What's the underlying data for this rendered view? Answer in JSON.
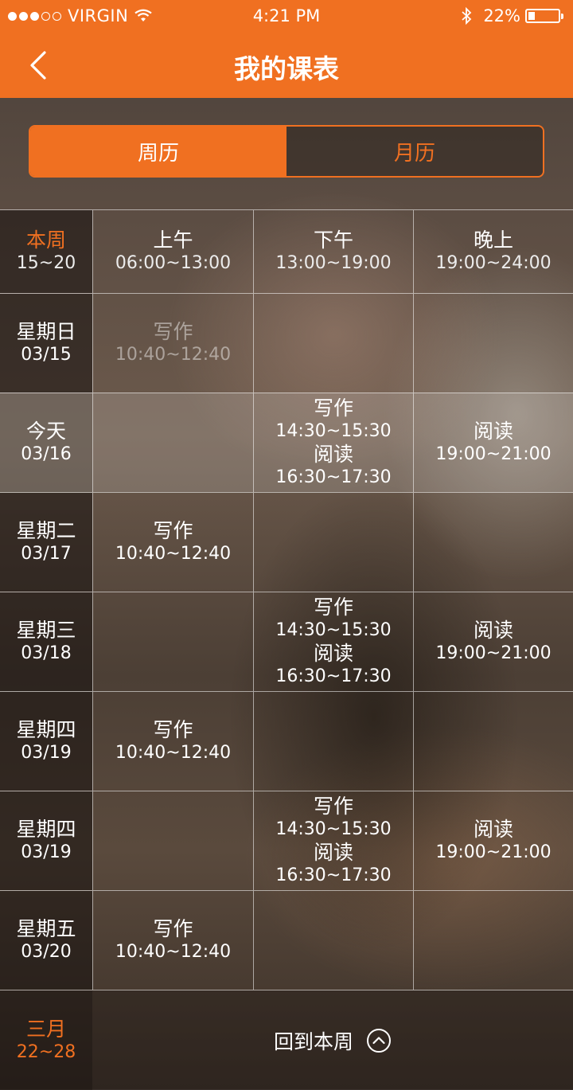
{
  "status_bar": {
    "carrier": "VIRGIN",
    "time": "4:21 PM",
    "battery": "22%",
    "battery_level": 0.22,
    "signal_bars_filled": 3,
    "signal_bars_total": 5
  },
  "nav": {
    "title": "我的课表",
    "back_icon": "chevron-left-icon"
  },
  "segment": {
    "week_label": "周历",
    "month_label": "月历",
    "selected": "周历"
  },
  "header": {
    "week_label": "本周",
    "week_range": "15~20",
    "morning": {
      "label": "上午",
      "time": "06:00~13:00"
    },
    "afternoon": {
      "label": "下午",
      "time": "13:00~19:00"
    },
    "evening": {
      "label": "晚上",
      "time": "19:00~24:00"
    }
  },
  "rows": [
    {
      "day": "星期日",
      "date": "03/15",
      "morning": {
        "course": "写作",
        "time": "10:40~12:40"
      }
    },
    {
      "day": "今天",
      "date": "03/16",
      "afternoon": [
        {
          "course": "写作",
          "time": "14:30~15:30"
        },
        {
          "course": "阅读",
          "time": "16:30~17:30"
        }
      ],
      "evening": {
        "course": "阅读",
        "time": "19:00~21:00"
      }
    },
    {
      "day": "星期二",
      "date": "03/17",
      "morning": {
        "course": "写作",
        "time": "10:40~12:40"
      }
    },
    {
      "day": "星期三",
      "date": "03/18",
      "afternoon": [
        {
          "course": "写作",
          "time": "14:30~15:30"
        },
        {
          "course": "阅读",
          "time": "16:30~17:30"
        }
      ],
      "evening": {
        "course": "阅读",
        "time": "19:00~21:00"
      }
    },
    {
      "day": "星期四",
      "date": "03/19",
      "morning": {
        "course": "写作",
        "time": "10:40~12:40"
      }
    },
    {
      "day": "星期四",
      "date": "03/19",
      "afternoon": [
        {
          "course": "写作",
          "time": "14:30~15:30"
        },
        {
          "course": "阅读",
          "time": "16:30~17:30"
        }
      ],
      "evening": {
        "course": "阅读",
        "time": "19:00~21:00"
      }
    },
    {
      "day": "星期五",
      "date": "03/20",
      "morning": {
        "course": "写作",
        "time": "10:40~12:40"
      }
    }
  ],
  "footer": {
    "month_label": "三月",
    "month_range": "22~28",
    "back_to_week": "回到本周",
    "icon": "chevron-up-circle-icon"
  },
  "colors": {
    "accent": "#f07021",
    "text": "#ffffff",
    "past_text": "#8a8580"
  }
}
